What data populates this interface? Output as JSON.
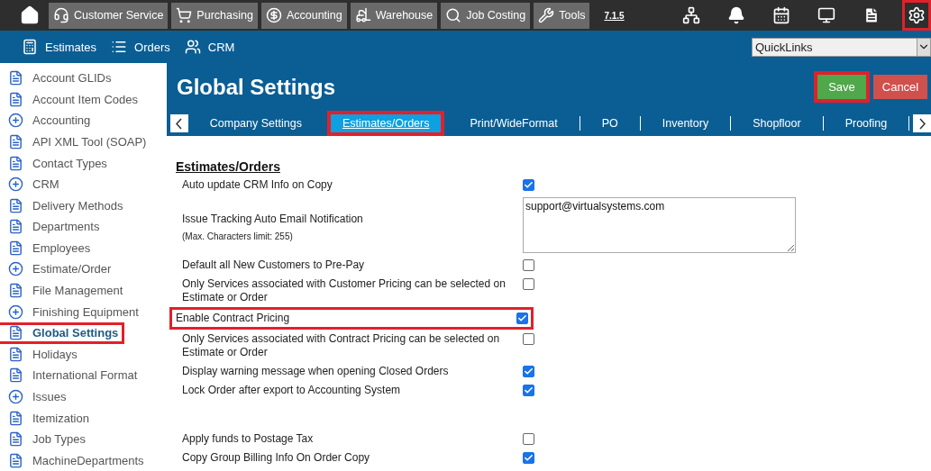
{
  "top_bar": {
    "modules": [
      {
        "label": "Customer Service"
      },
      {
        "label": "Purchasing"
      },
      {
        "label": "Accounting"
      },
      {
        "label": "Warehouse"
      },
      {
        "label": "Job Costing"
      },
      {
        "label": "Tools"
      }
    ],
    "version": "7.1.5",
    "actions": [
      {
        "highlighted": false
      },
      {
        "highlighted": false
      },
      {
        "highlighted": false
      },
      {
        "highlighted": false
      },
      {
        "highlighted": false
      },
      {
        "highlighted": true
      }
    ]
  },
  "nav_bar": {
    "items": [
      {
        "label": "Estimates"
      },
      {
        "label": "Orders"
      },
      {
        "label": "CRM"
      }
    ],
    "quicklinks": {
      "value": "QuickLinks"
    }
  },
  "sidebar": {
    "items": [
      {
        "label": "Account GLIDs",
        "kind": "page",
        "selected": false
      },
      {
        "label": "Account Item Codes",
        "kind": "page",
        "selected": false
      },
      {
        "label": "Accounting",
        "kind": "group",
        "selected": false
      },
      {
        "label": "API XML Tool (SOAP)",
        "kind": "page",
        "selected": false
      },
      {
        "label": "Contact Types",
        "kind": "page",
        "selected": false
      },
      {
        "label": "CRM",
        "kind": "group",
        "selected": false
      },
      {
        "label": "Delivery Methods",
        "kind": "page",
        "selected": false
      },
      {
        "label": "Departments",
        "kind": "page",
        "selected": false
      },
      {
        "label": "Employees",
        "kind": "page",
        "selected": false
      },
      {
        "label": "Estimate/Order",
        "kind": "group",
        "selected": false
      },
      {
        "label": "File Management",
        "kind": "page",
        "selected": false
      },
      {
        "label": "Finishing Equipment",
        "kind": "group",
        "selected": false
      },
      {
        "label": "Global Settings",
        "kind": "page",
        "selected": true
      },
      {
        "label": "Holidays",
        "kind": "page",
        "selected": false
      },
      {
        "label": "International Format",
        "kind": "page",
        "selected": false
      },
      {
        "label": "Issues",
        "kind": "group",
        "selected": false
      },
      {
        "label": "Itemization",
        "kind": "page",
        "selected": false
      },
      {
        "label": "Job Types",
        "kind": "page",
        "selected": false
      },
      {
        "label": "MachineDepartments",
        "kind": "page",
        "selected": false
      }
    ]
  },
  "header": {
    "title": "Global Settings",
    "buttons": [
      {
        "label": "Save",
        "kind": "save",
        "highlighted": true
      },
      {
        "label": "Cancel",
        "kind": "cancel",
        "highlighted": false
      }
    ]
  },
  "tabs": [
    {
      "label": "Company Settings",
      "selected": false
    },
    {
      "label": "Estimates/Orders",
      "selected": true
    },
    {
      "label": "Print/WideFormat",
      "selected": false
    },
    {
      "label": "PO",
      "selected": false
    },
    {
      "label": "Inventory",
      "selected": false
    },
    {
      "label": "Shopfloor",
      "selected": false
    },
    {
      "label": "Proofing",
      "selected": false
    }
  ],
  "section": {
    "title": "Estimates/Orders",
    "settings": [
      {
        "kind": "checkbox",
        "label": "Auto update CRM Info on Copy",
        "checked": true,
        "highlighted": false
      },
      {
        "kind": "textarea",
        "label": "Issue Tracking Auto Email Notification",
        "note": "(Max. Characters limit: 255)",
        "value": "support@virtualsystems.com"
      },
      {
        "kind": "checkbox",
        "label": "Default all New Customers to Pre-Pay",
        "checked": false,
        "highlighted": false
      },
      {
        "kind": "checkbox",
        "label": "Only Services associated with Customer Pricing can be selected on Estimate or Order",
        "checked": false,
        "highlighted": false
      },
      {
        "kind": "checkbox",
        "label": "Enable Contract Pricing",
        "checked": true,
        "highlighted": true
      },
      {
        "kind": "checkbox",
        "label": "Only Services associated with Contract Pricing can be selected on Estimate or Order",
        "checked": false,
        "highlighted": false
      },
      {
        "kind": "checkbox",
        "label": "Display warning message when opening Closed Orders",
        "checked": true,
        "highlighted": false
      },
      {
        "kind": "checkbox",
        "label": "Lock Order after export to Accounting System",
        "checked": true,
        "highlighted": false
      },
      {
        "kind": "spacer"
      },
      {
        "kind": "checkbox",
        "label": "Apply funds to Postage Tax",
        "checked": false,
        "highlighted": false
      },
      {
        "kind": "checkbox",
        "label": "Copy Group Billing Info On Order Copy",
        "checked": true,
        "highlighted": false
      }
    ]
  }
}
